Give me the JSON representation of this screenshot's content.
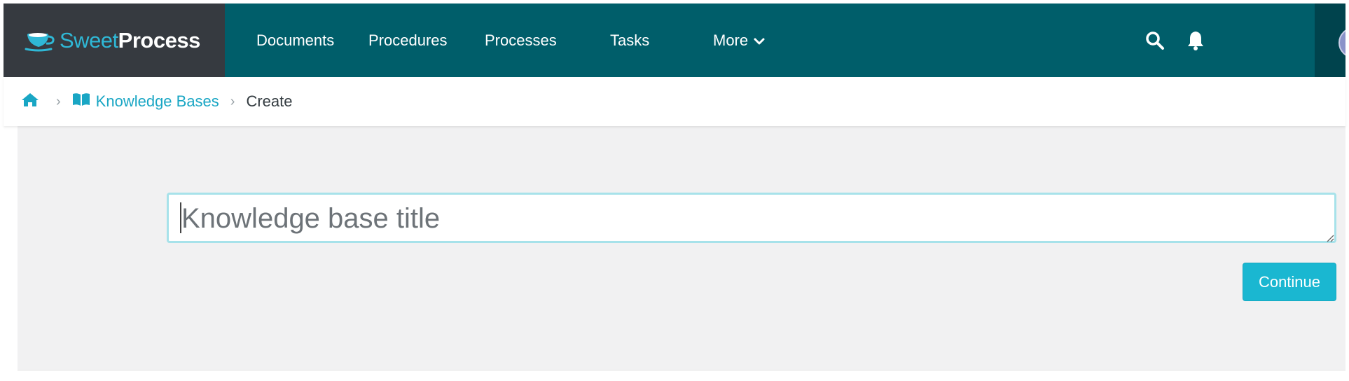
{
  "brand": {
    "name_light": "Sweet",
    "name_bold": "Process",
    "icon": "teacup-icon",
    "accent_color": "#2fb8d6"
  },
  "nav": {
    "items": [
      {
        "label": "Documents"
      },
      {
        "label": "Procedures"
      },
      {
        "label": "Processes"
      },
      {
        "label": "Tasks"
      },
      {
        "label": "More",
        "icon": "chevron-down-icon"
      }
    ],
    "background_color": "#005e6a"
  },
  "top_icons": {
    "search": "search-icon",
    "notifications": "bell-icon",
    "avatar": "avatar"
  },
  "breadcrumb": {
    "home_icon": "home-icon",
    "kb_icon": "book-open-icon",
    "kb_label": "Knowledge Bases",
    "current": "Create",
    "separator": "›"
  },
  "form": {
    "title_value": "",
    "title_placeholder": "Knowledge base title",
    "continue_label": "Continue",
    "button_color": "#1ab7d1"
  }
}
